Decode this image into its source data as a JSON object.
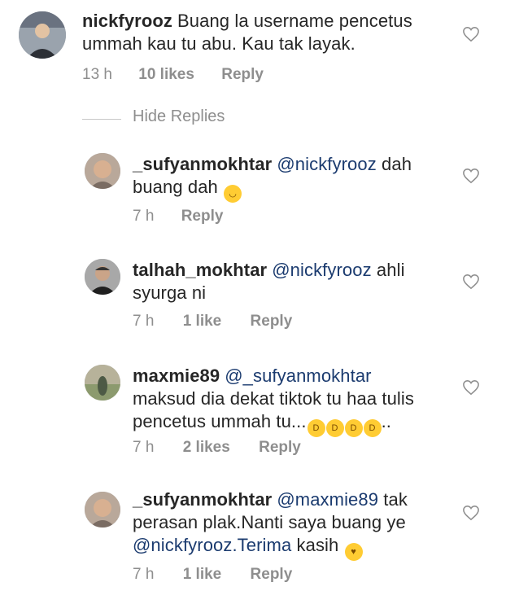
{
  "comments": [
    {
      "username": "nickfyrooz",
      "text_parts": [
        "Buang la username pencetus",
        "ummah kau tu abu. Kau tak layak."
      ],
      "time": "13 h",
      "likes": "10 likes",
      "reply": "Reply"
    },
    {
      "username": "_sufyanmokhtar",
      "mention": "@nickfyrooz",
      "text_after": "dah",
      "line2": "buang dah",
      "time": "7 h",
      "reply": "Reply"
    },
    {
      "username": "talhah_mokhtar",
      "mention": "@nickfyrooz",
      "text_after": "ahli",
      "line2": "syurga ni",
      "time": "7 h",
      "likes": "1 like",
      "reply": "Reply"
    },
    {
      "username": "maxmie89",
      "mention": "@_sufyanmokhtar",
      "line2": "maksud dia dekat tiktok tu haa tulis",
      "line3": "pencetus ummah tu...",
      "line3_tail": "..",
      "time": "7 h",
      "likes": "2 likes",
      "reply": "Reply"
    },
    {
      "username": "_sufyanmokhtar",
      "mention": "@maxmie89",
      "text_after": "tak",
      "line2": "perasan plak.Nanti saya buang ye",
      "mention2": "@nickfyrooz.Terima",
      "line3_after": "kasih",
      "time": "7 h",
      "likes": "1 like",
      "reply": "Reply"
    }
  ],
  "hide_replies": "Hide Replies",
  "icons": {
    "like": "heart-outline-icon",
    "emoji_smile": "smiling-face-icon",
    "emoji_laugh": "rolling-laughing-face-icon",
    "emoji_grin": "grinning-sweat-face-icon",
    "emoji_love": "smiling-face-with-hearts-icon"
  },
  "colors": {
    "text": "#262626",
    "meta": "#8e8e8e",
    "mention": "#1b3b6f",
    "emoji": "#ffcc33"
  }
}
